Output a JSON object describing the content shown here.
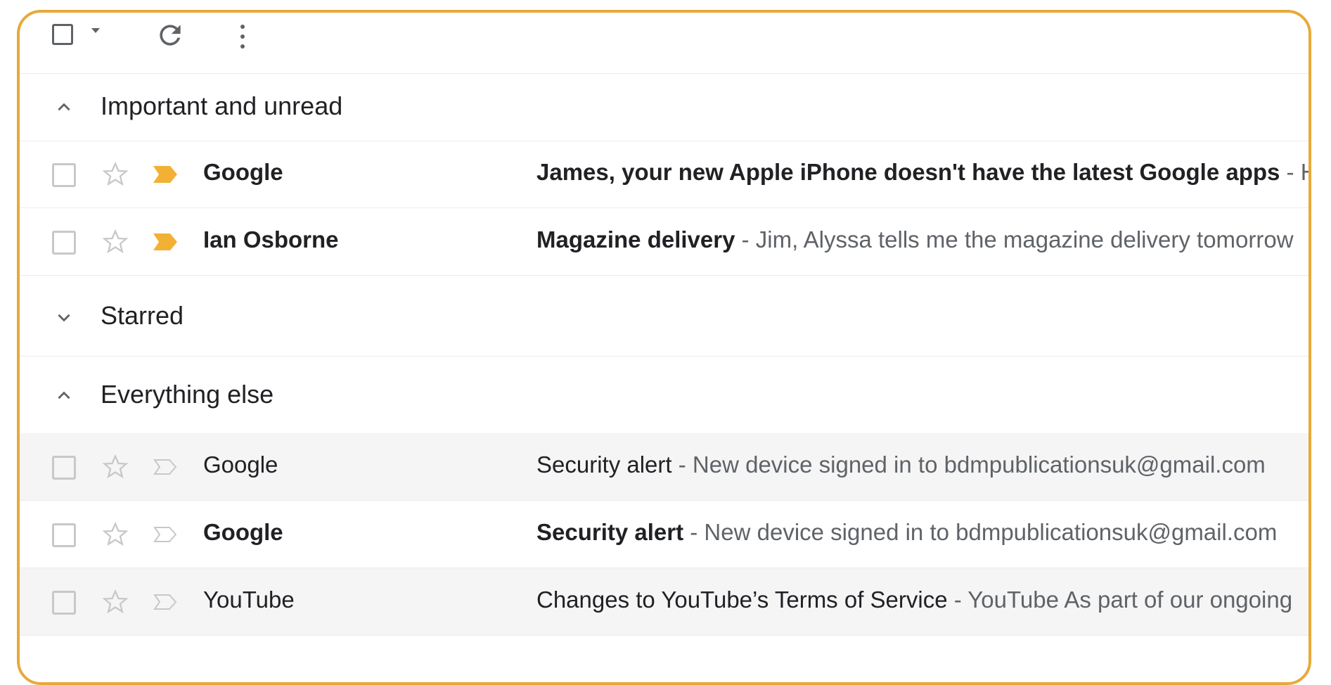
{
  "colors": {
    "frame": "#e8a93a",
    "important_marker": "#f2b134",
    "read_row_bg": "#f5f5f5"
  },
  "toolbar": {
    "select_all_icon": "checkbox-icon",
    "select_menu_icon": "caret-down-icon",
    "refresh_icon": "refresh-icon",
    "more_icon": "more-vertical-icon"
  },
  "sections": [
    {
      "label": "Important and unread",
      "expanded": true
    },
    {
      "label": "Starred",
      "expanded": false
    },
    {
      "label": "Everything else",
      "expanded": true
    }
  ],
  "emails_important": [
    {
      "sender": "Google",
      "subject": "James, your new Apple iPhone doesn't have the latest Google apps",
      "snippet": " - Hi",
      "unread": true,
      "important": true
    },
    {
      "sender": "Ian Osborne",
      "subject": "Magazine delivery",
      "snippet": " - Jim, Alyssa tells me the magazine delivery tomorrow",
      "unread": true,
      "important": true
    }
  ],
  "emails_other": [
    {
      "sender": "Google",
      "subject": "Security alert",
      "snippet": " - New device signed in to bdmpublicationsuk@gmail.com",
      "unread": false,
      "important": false
    },
    {
      "sender": "Google",
      "subject": "Security alert",
      "snippet": " - New device signed in to bdmpublicationsuk@gmail.com",
      "unread": true,
      "important": false
    },
    {
      "sender": "YouTube",
      "subject": "Changes to YouTube’s Terms of Service",
      "snippet": " - YouTube As part of our ongoing",
      "unread": false,
      "important": false
    }
  ]
}
